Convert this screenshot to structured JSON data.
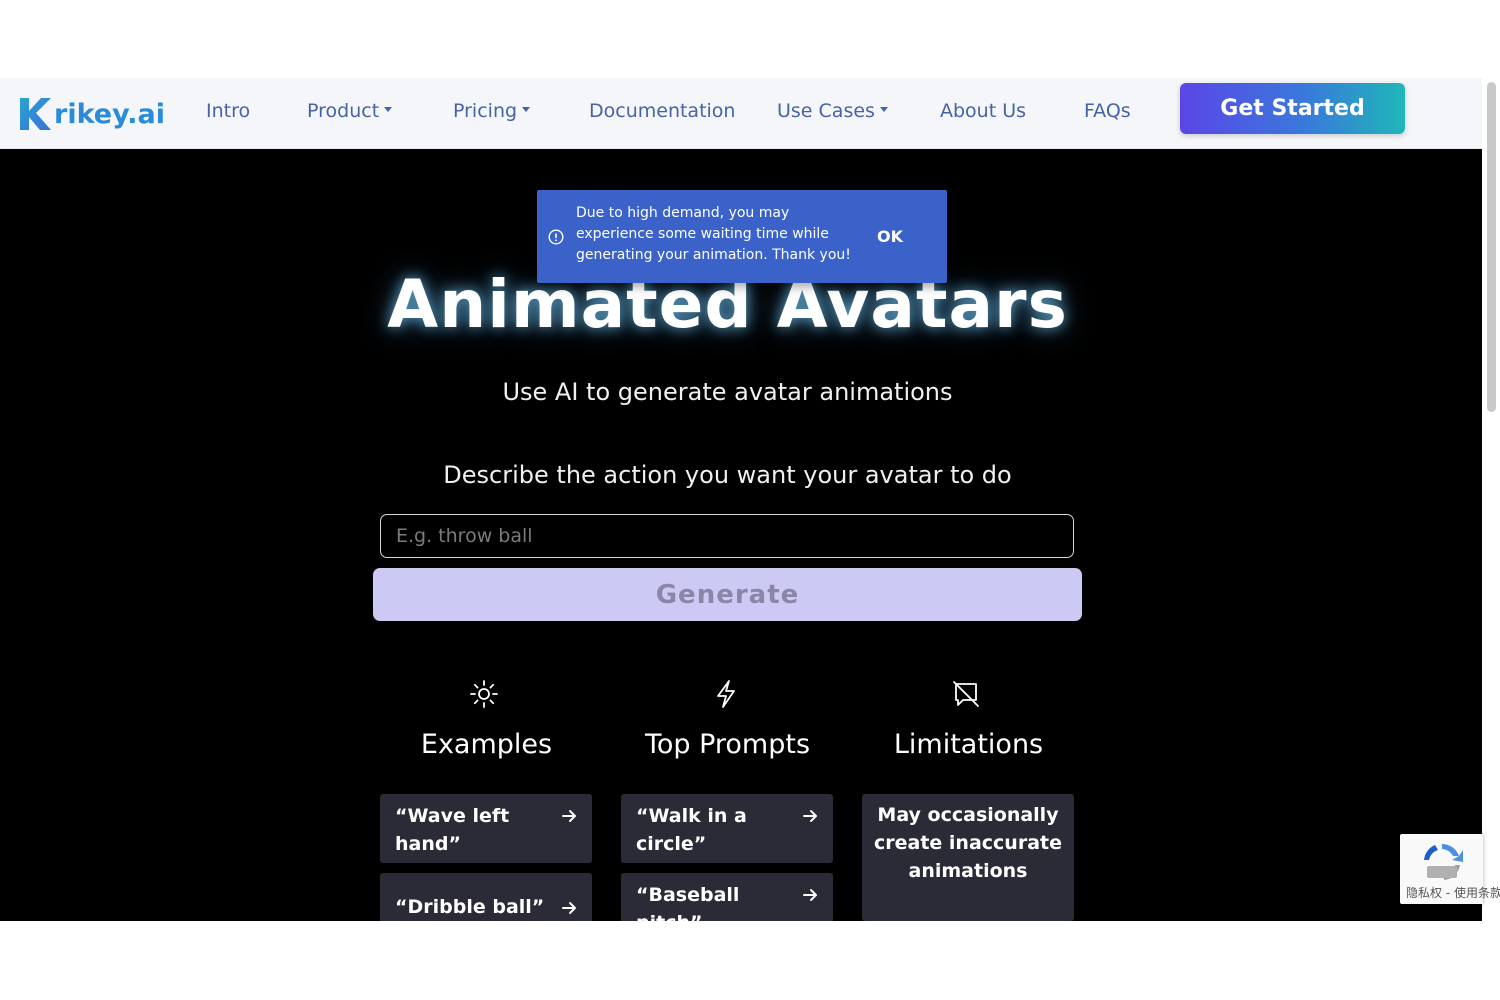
{
  "nav": {
    "logo_text": "rikey.ai",
    "items": [
      {
        "label": "Intro"
      },
      {
        "label": "Product"
      },
      {
        "label": "Pricing"
      },
      {
        "label": "Documentation"
      },
      {
        "label": "Use Cases"
      },
      {
        "label": "About Us"
      },
      {
        "label": "FAQs"
      }
    ],
    "cta_label": "Get Started"
  },
  "toast": {
    "message": "Due to high demand, you may experience some waiting time while generating your animation. Thank you!",
    "ok_label": "OK"
  },
  "hero": {
    "title": "Animated Avatars",
    "subtitle": "Use AI to generate avatar animations",
    "describe_label": "Describe the action you want your avatar to do",
    "input_placeholder": "E.g. throw ball",
    "input_value": "",
    "generate_label": "Generate"
  },
  "columns": {
    "examples": {
      "title": "Examples",
      "icon": "sun-icon",
      "items": [
        "“Wave left hand”",
        "“Dribble ball”"
      ]
    },
    "top_prompts": {
      "title": "Top Prompts",
      "icon": "lightning-icon",
      "items": [
        "“Walk in a circle”",
        "“Baseball pitch”"
      ]
    },
    "limitations": {
      "title": "Limitations",
      "icon": "message-off-icon",
      "items": [
        "May occasionally create inaccurate animations"
      ]
    }
  },
  "recaptcha": {
    "text": "隐私权 - 使用条款"
  },
  "colors": {
    "brand": "#2a8bd8",
    "nav_text": "#4763a8",
    "toast_bg": "#3a62c9",
    "generate_disabled": "#cdc9f5",
    "card_bg": "#2a2b36"
  }
}
